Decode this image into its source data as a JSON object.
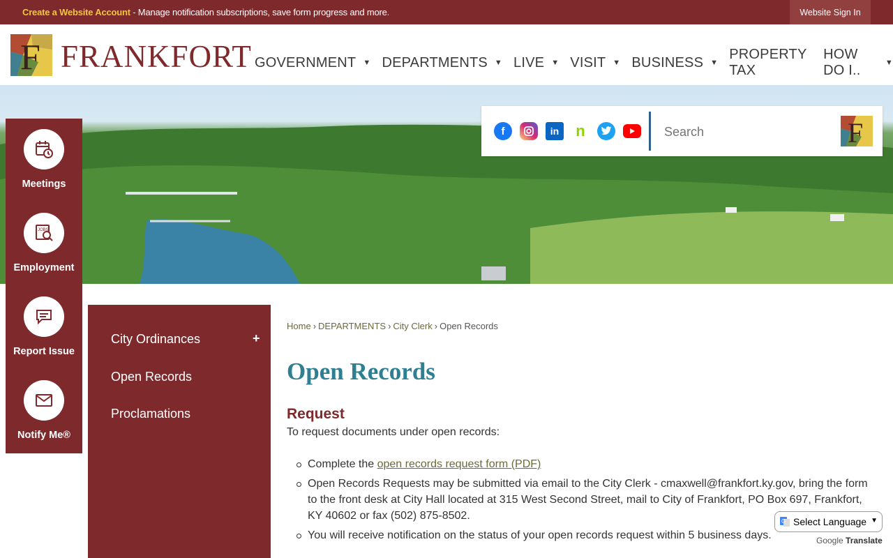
{
  "topbar": {
    "account_link": "Create a Website Account",
    "message": " - Manage notification subscriptions, save form progress and more.",
    "signin_label": "Website Sign In"
  },
  "header": {
    "logo_text": "FRANKFORT",
    "nav": [
      {
        "label": "GOVERNMENT",
        "has_caret": true
      },
      {
        "label": "DEPARTMENTS",
        "has_caret": true
      },
      {
        "label": "LIVE",
        "has_caret": true
      },
      {
        "label": "VISIT",
        "has_caret": true
      },
      {
        "label": "BUSINESS",
        "has_caret": true
      },
      {
        "label": "PROPERTY TAX",
        "has_caret": false
      },
      {
        "label": "HOW DO I..",
        "has_caret": true
      }
    ],
    "caret_glyph": "▼"
  },
  "search": {
    "placeholder": "Search",
    "social": [
      {
        "name": "facebook-icon",
        "color": "#1877f2"
      },
      {
        "name": "instagram-icon",
        "color": "#d62976"
      },
      {
        "name": "linkedin-icon",
        "color": "#0a66c2"
      },
      {
        "name": "nextdoor-icon",
        "color": "#8ed500"
      },
      {
        "name": "twitter-icon",
        "color": "#1da1f2"
      },
      {
        "name": "youtube-icon",
        "color": "#ff0000"
      }
    ]
  },
  "quick_links": [
    {
      "label": "Meetings",
      "icon": "calendar-icon"
    },
    {
      "label": "Employment",
      "icon": "jobs-icon"
    },
    {
      "label": "Report Issue",
      "icon": "chat-icon"
    },
    {
      "label": "Notify Me®",
      "icon": "mail-icon"
    }
  ],
  "side_menu": {
    "items": [
      {
        "label": "City Ordinances"
      },
      {
        "label": "Open Records"
      },
      {
        "label": "Proclamations"
      }
    ],
    "expand_glyph": "+"
  },
  "breadcrumb": {
    "home": "Home",
    "departments": "DEPARTMENTS",
    "city_clerk": "City Clerk",
    "current": "Open Records",
    "separator": "›"
  },
  "page": {
    "title": "Open Records",
    "section_title": "Request",
    "intro": "To request documents under open records:",
    "bullet1_prefix": "Complete the ",
    "bullet1_link": "open records request form (PDF)",
    "bullet2": "Open Records Requests may be submitted via email to the City Clerk - cmaxwell@frankfort.ky.gov, bring the form to the front desk at City Hall located at 315 West Second Street, mail to City of Frankfort, PO Box 697, Frankfort, KY  40602 or fax (502) 875-8502.",
    "bullet3": "You will receive notification on the status of your open records request within 5 business days."
  },
  "translate": {
    "select_label": "Select Language",
    "powered_prefix": "Google",
    "powered_suffix": "Translate"
  },
  "colors": {
    "brand": "#7e2a2c",
    "title_teal": "#2e7f92",
    "link_olive": "#6b6a3a",
    "topbar_accent": "#f0c63c"
  }
}
